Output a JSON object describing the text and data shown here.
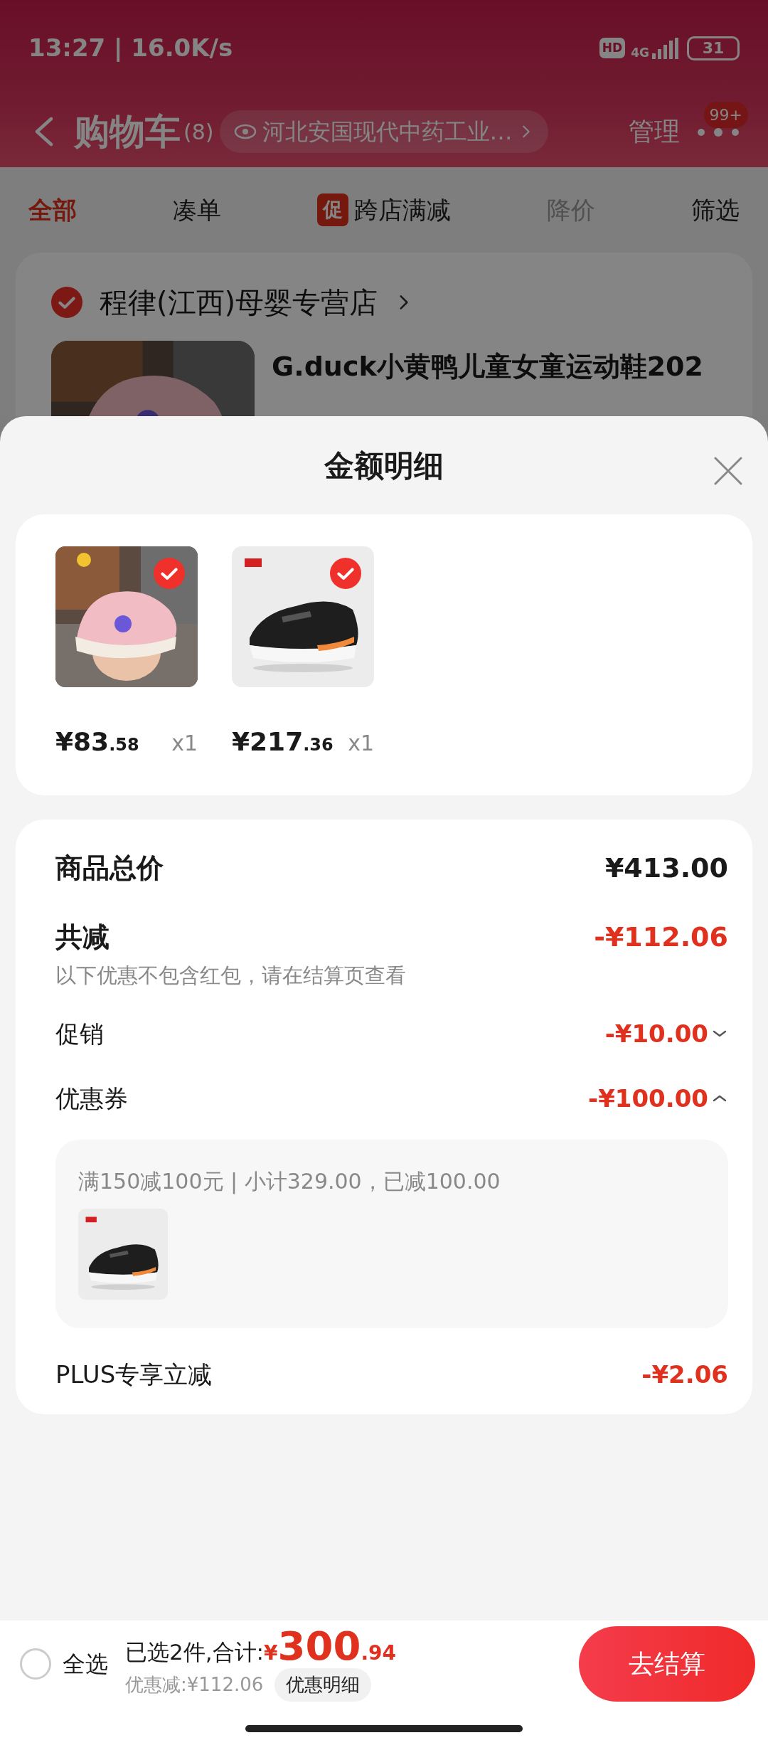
{
  "status_bar": {
    "time": "13:27 | 16.0K/s",
    "hd": "HD",
    "network": "4G",
    "battery": "31"
  },
  "header": {
    "title": "购物车",
    "count": "(8)",
    "address": "河北安国现代中药工业…",
    "manage": "管理",
    "badge": "99+"
  },
  "filter_tabs": [
    {
      "label": "全部",
      "selected": true,
      "disabled": false
    },
    {
      "label": "凑单",
      "selected": false,
      "disabled": false
    },
    {
      "label": "跨店满减",
      "tag": "促",
      "selected": false,
      "disabled": false
    },
    {
      "label": "降价",
      "selected": false,
      "disabled": true
    },
    {
      "label": "筛选",
      "selected": false,
      "disabled": false
    }
  ],
  "store": {
    "name": "程律(江西)母婴专营店",
    "checked": true,
    "product_title": "G.duck小黄鸭儿童女童运动鞋202"
  },
  "sheet": {
    "title": "金额明细",
    "items": [
      {
        "kind": "kids_shoe",
        "price_main": "¥83",
        "price_cents": ".58",
        "qty": "x1",
        "checked": true
      },
      {
        "kind": "sport_shoe",
        "price_main": "¥217",
        "price_cents": ".36",
        "qty": "x1",
        "checked": true
      }
    ],
    "total": {
      "label": "商品总价",
      "value": "¥413.00"
    },
    "discount": {
      "label": "共减",
      "value": "-¥112.06",
      "note": "以下优惠不包含红包，请在结算页查看"
    },
    "lines": [
      {
        "kind": "collapsible",
        "label": "促销",
        "value": "-¥10.00",
        "expanded": false
      },
      {
        "kind": "collapsible",
        "label": "优惠券",
        "value": "-¥100.00",
        "expanded": true,
        "detail": {
          "text": "满150减100元 | 小计329.00，已减100.00",
          "items": [
            {
              "kind": "sport_shoe"
            }
          ]
        }
      },
      {
        "kind": "plain",
        "label": "PLUS专享立减",
        "value": "-¥2.06"
      }
    ]
  },
  "bottom_bar": {
    "select_all": {
      "label": "全选",
      "checked": false
    },
    "summary": "已选2件,合计:",
    "currency": "¥",
    "amount_main": "300",
    "amount_cents": ".94",
    "saved": "优惠减:¥112.06",
    "detail_button": "优惠明细",
    "checkout": "去结算"
  }
}
